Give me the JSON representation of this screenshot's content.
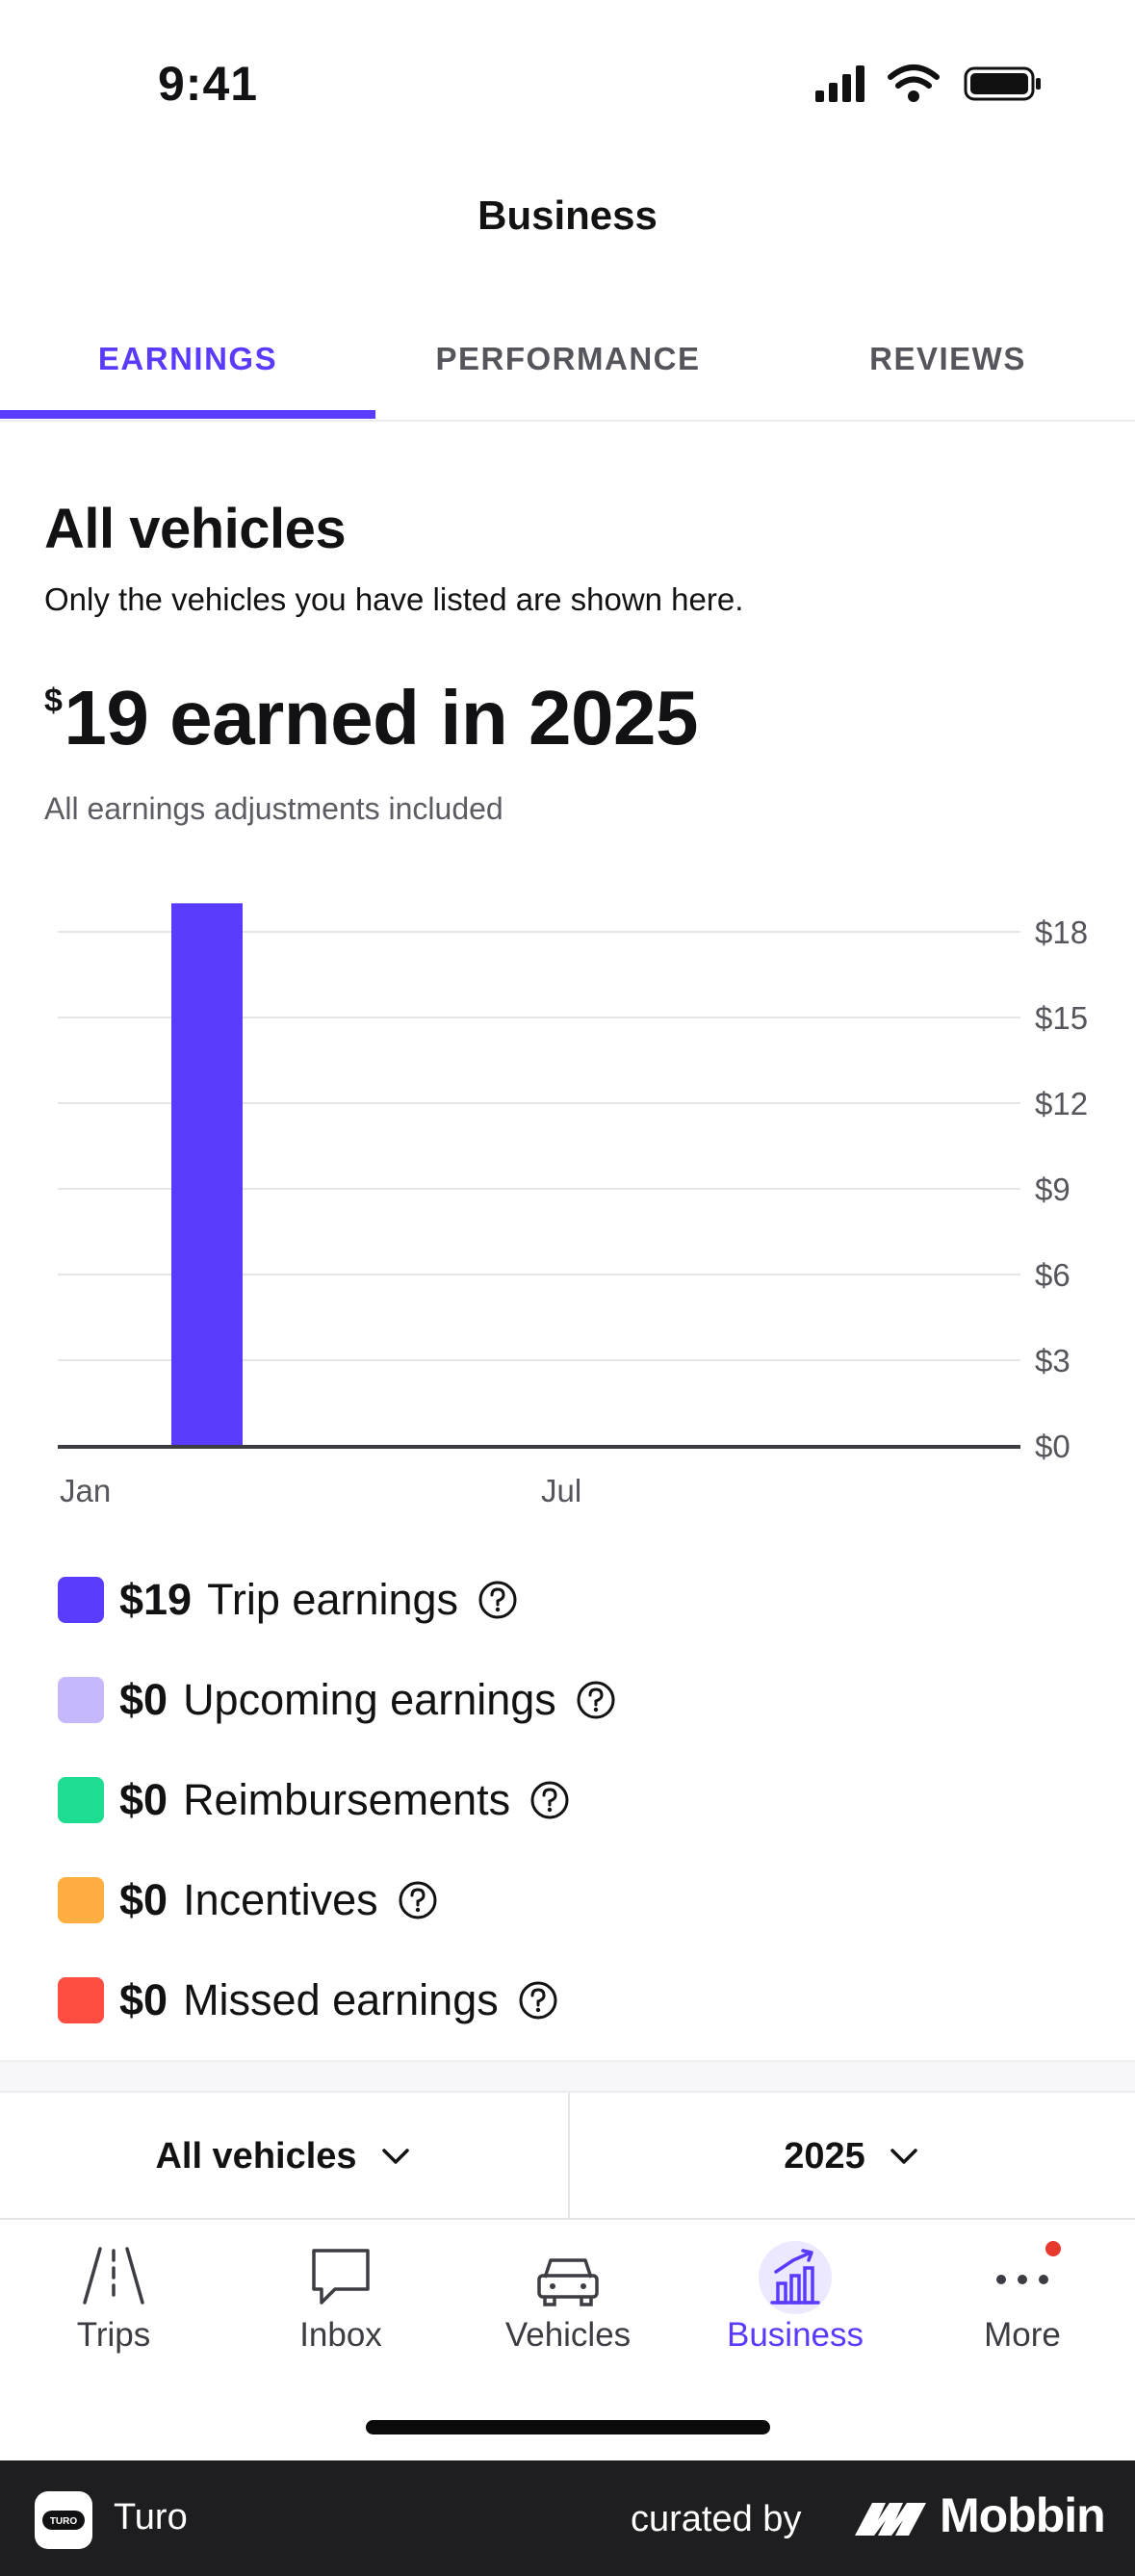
{
  "status_bar": {
    "time": "9:41"
  },
  "header": {
    "title": "Business"
  },
  "tabs": [
    {
      "label": "EARNINGS",
      "active": true
    },
    {
      "label": "PERFORMANCE",
      "active": false
    },
    {
      "label": "REVIEWS",
      "active": false
    }
  ],
  "summary": {
    "title": "All vehicles",
    "subtitle": "Only the vehicles you have listed are shown here.",
    "currency_symbol": "$",
    "earned_text": "19 earned in 2025",
    "note": "All earnings adjustments included"
  },
  "chart_data": {
    "type": "bar",
    "categories": [
      "Jan",
      "Feb",
      "Mar",
      "Apr",
      "May",
      "Jun",
      "Jul",
      "Aug",
      "Sep",
      "Oct",
      "Nov",
      "Dec"
    ],
    "values": [
      0,
      19,
      0,
      0,
      0,
      0,
      0,
      0,
      0,
      0,
      0,
      0
    ],
    "x_tick_labels": [
      "Jan",
      "",
      "",
      "",
      "",
      "",
      "Jul",
      "",
      "",
      "",
      "",
      ""
    ],
    "y_ticks": [
      "$0",
      "$3",
      "$6",
      "$9",
      "$12",
      "$15",
      "$18"
    ],
    "ylim": [
      0,
      18
    ],
    "bar_color": "#593cfb",
    "grid": true,
    "y_axis_position": "right"
  },
  "legend": [
    {
      "value": "$19",
      "label": "Trip earnings",
      "color": "#593cfb"
    },
    {
      "value": "$0",
      "label": "Upcoming earnings",
      "color": "#c7b8fb"
    },
    {
      "value": "$0",
      "label": "Reimbursements",
      "color": "#1fdc93"
    },
    {
      "value": "$0",
      "label": "Incentives",
      "color": "#ffae42"
    },
    {
      "value": "$0",
      "label": "Missed earnings",
      "color": "#ff4d42"
    }
  ],
  "filters": {
    "vehicle": "All vehicles",
    "year": "2025"
  },
  "bottom_nav": [
    {
      "label": "Trips",
      "icon": "road-icon",
      "active": false
    },
    {
      "label": "Inbox",
      "icon": "chat-bubble-icon",
      "active": false
    },
    {
      "label": "Vehicles",
      "icon": "car-icon",
      "active": false
    },
    {
      "label": "Business",
      "icon": "chart-trend-icon",
      "active": true
    },
    {
      "label": "More",
      "icon": "more-dots-icon",
      "active": false,
      "badge": true
    }
  ],
  "colors": {
    "accent": "#593cfb",
    "badge": "#e8392f"
  },
  "footer": {
    "app_name": "Turo",
    "logo_text": "TURO",
    "curated_by": "curated by",
    "brand": "Mobbin"
  }
}
